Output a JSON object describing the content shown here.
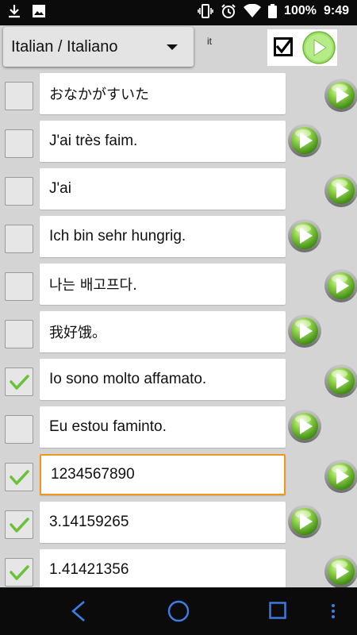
{
  "status_bar": {
    "battery": "100%",
    "time": "9:49"
  },
  "header": {
    "language": "Italian / Italiano",
    "language_code": "it"
  },
  "rows": [
    {
      "text": "おなかがすいた",
      "checked": false
    },
    {
      "text": "J'ai très faim.",
      "checked": false
    },
    {
      "text": "J'ai",
      "checked": false
    },
    {
      "text": "Ich bin sehr hungrig.",
      "checked": false
    },
    {
      "text": "나는 배고프다.",
      "checked": false
    },
    {
      "text": "我好饿。",
      "checked": false
    },
    {
      "text": "Io sono molto affamato.",
      "checked": true
    },
    {
      "text": "Eu estou faminto.",
      "checked": false
    },
    {
      "text": "1234567890",
      "checked": true
    },
    {
      "text": "3.14159265",
      "checked": true
    },
    {
      "text": "1.41421356",
      "checked": true
    }
  ],
  "colors": {
    "focus_border": "#f0961a",
    "play_green": "#7ac943",
    "nav_blue": "#3d7ee6"
  },
  "icons": [
    "download-icon",
    "image-icon",
    "vibrate-icon",
    "alarm-icon",
    "wifi-icon",
    "battery-icon",
    "checkbox-icon",
    "play-icon",
    "back-icon",
    "home-icon",
    "recents-icon",
    "more-icon"
  ]
}
